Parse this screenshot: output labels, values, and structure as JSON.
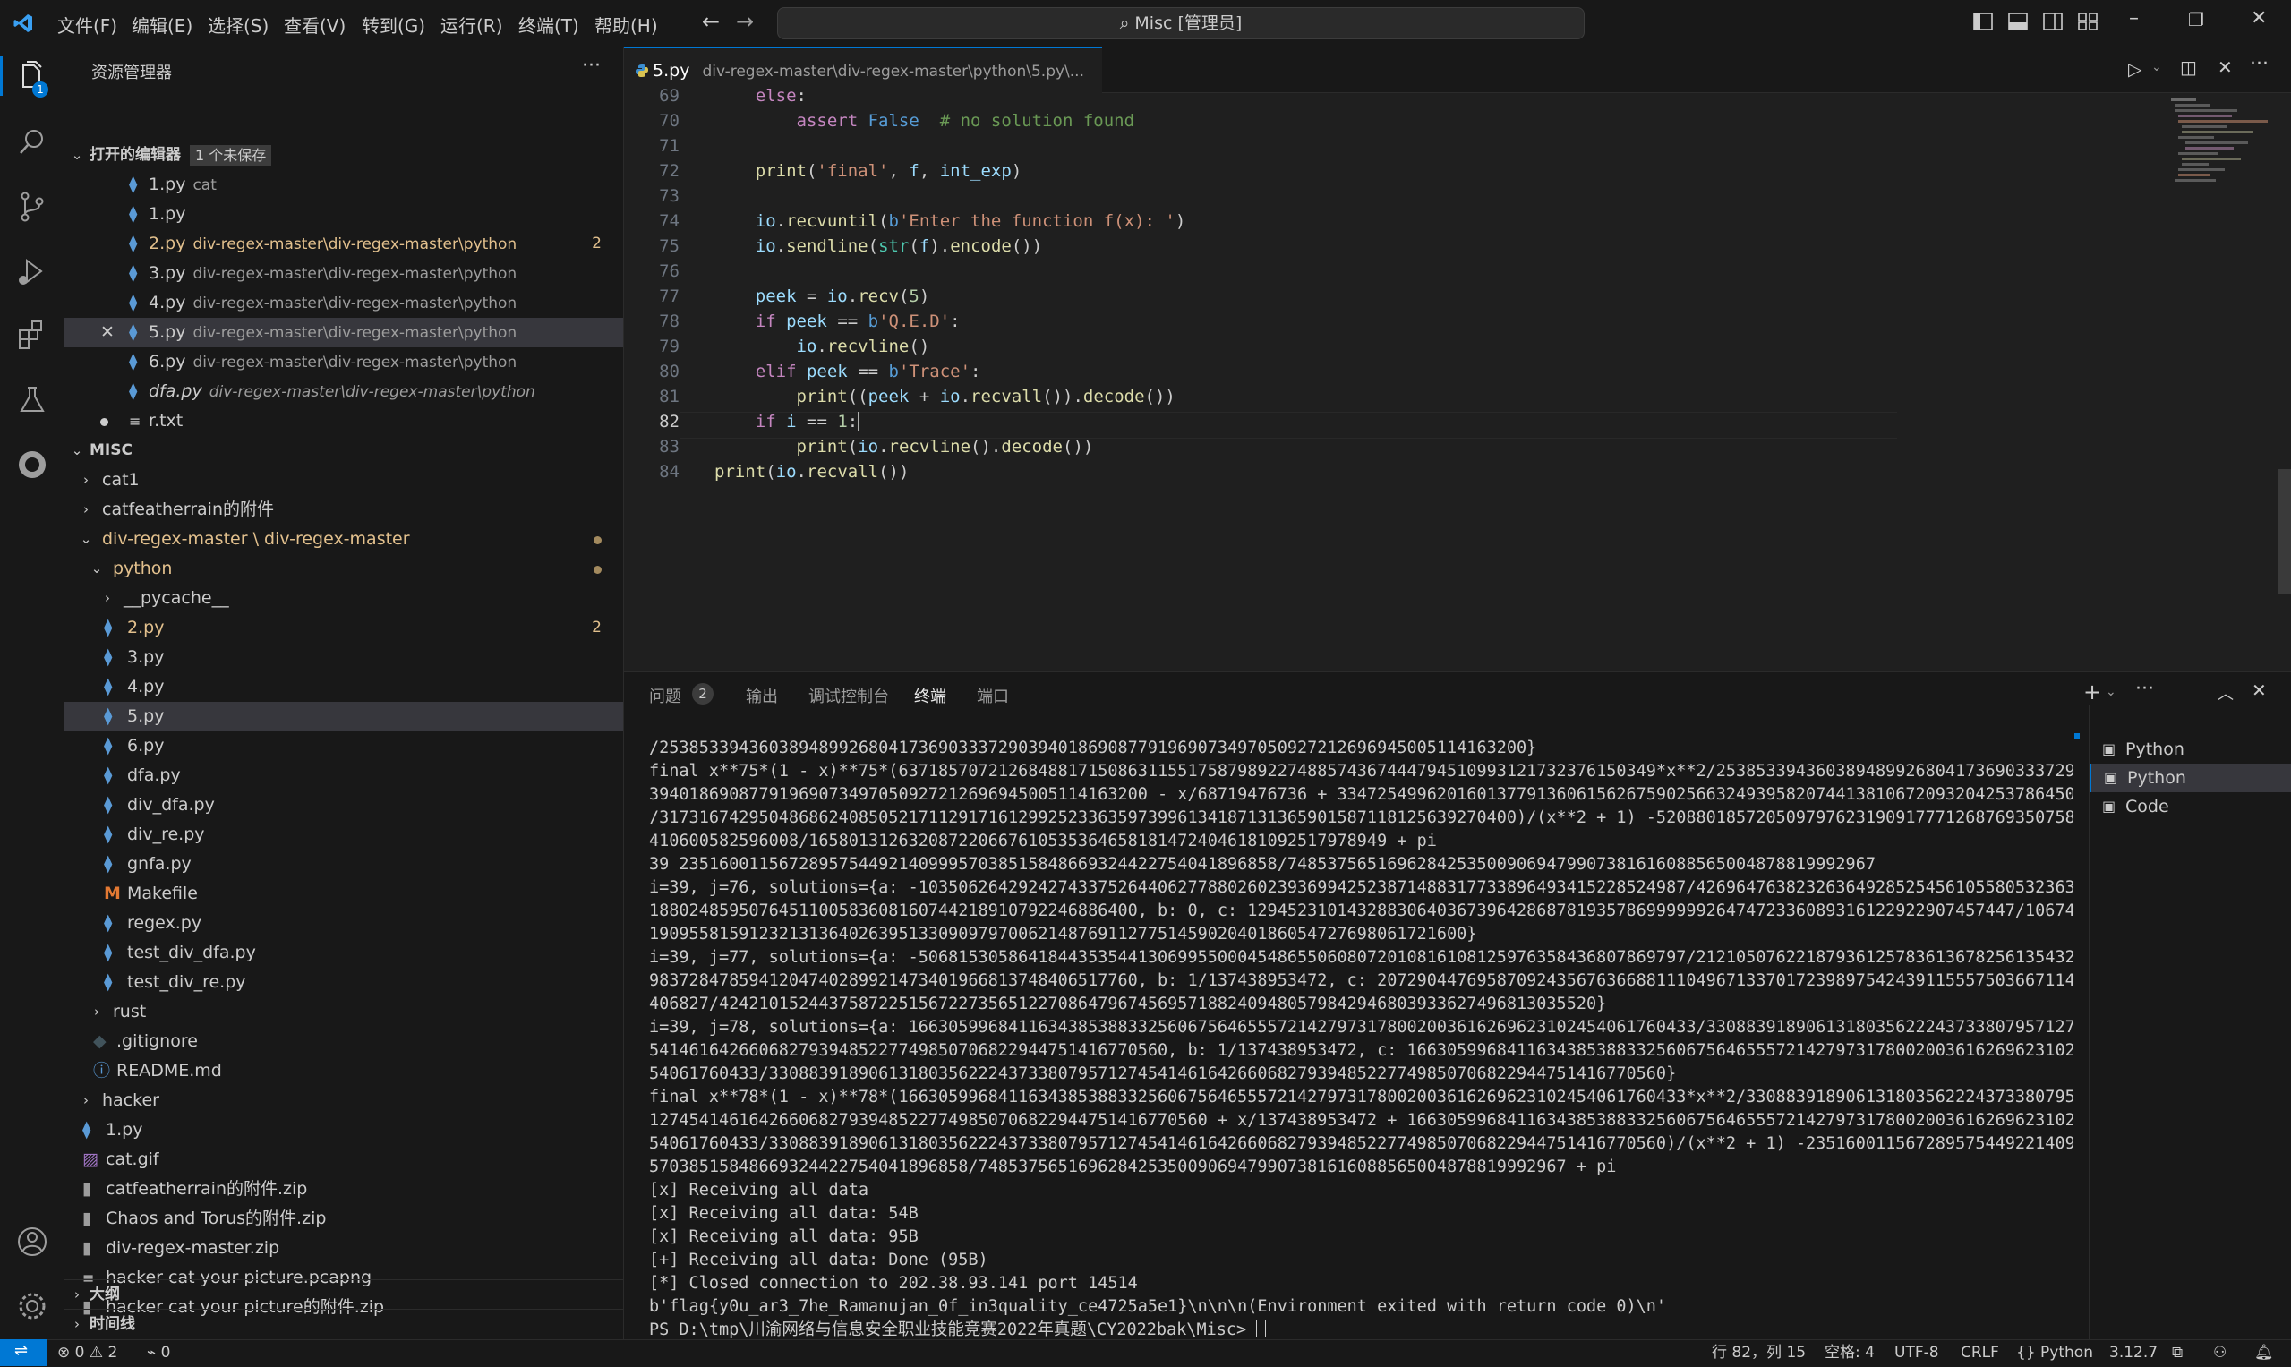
{
  "titlebar": {
    "menus": [
      "文件(F)",
      "编辑(E)",
      "选择(S)",
      "查看(V)",
      "转到(G)",
      "运行(R)",
      "终端(T)",
      "帮助(H)"
    ],
    "search": "Misc [管理员]"
  },
  "activity": {
    "explorer_badge": "1"
  },
  "sidebar": {
    "title": "资源管理器",
    "open_editors": {
      "label": "打开的编辑器",
      "unsaved": "1 个未保存",
      "items": [
        {
          "name": "1.py",
          "desc": "cat",
          "badge": ""
        },
        {
          "name": "1.py",
          "desc": "",
          "badge": ""
        },
        {
          "name": "2.py",
          "desc": "div-regex-master\\div-regex-master\\python",
          "badge": "2"
        },
        {
          "name": "3.py",
          "desc": "div-regex-master\\div-regex-master\\python",
          "badge": ""
        },
        {
          "name": "4.py",
          "desc": "div-regex-master\\div-regex-master\\python",
          "badge": ""
        },
        {
          "name": "5.py",
          "desc": "div-regex-master\\div-regex-master\\python",
          "badge": ""
        },
        {
          "name": "6.py",
          "desc": "div-regex-master\\div-regex-master\\python",
          "badge": ""
        },
        {
          "name": "dfa.py",
          "desc": "div-regex-master\\div-regex-master\\python",
          "badge": ""
        },
        {
          "name": "r.txt",
          "desc": "",
          "badge": ""
        }
      ]
    },
    "misc": {
      "label": "MISC",
      "items": [
        "cat1",
        "catfeatherrain的附件",
        "div-regex-master \\ div-regex-master",
        "python",
        "__pycache__",
        "2.py",
        "3.py",
        "4.py",
        "5.py",
        "6.py",
        "dfa.py",
        "div_dfa.py",
        "div_re.py",
        "gnfa.py",
        "Makefile",
        "regex.py",
        "test_div_dfa.py",
        "test_div_re.py",
        "rust",
        ".gitignore",
        "README.md",
        "hacker",
        "1.py",
        "cat.gif",
        "catfeatherrain的附件.zip",
        "Chaos and Torus的附件.zip",
        "div-regex-master.zip",
        "hacker cat your picture.pcapng",
        "hacker cat your picture的附件.zip"
      ],
      "badge_2py": "2"
    },
    "outline": "大纲",
    "timeline": "时间线"
  },
  "editor": {
    "tab_name": "5.py",
    "tab_path": "div-regex-master\\div-regex-master\\python\\5.py\\...",
    "line_numbers": [
      "69",
      "70",
      "71",
      "72",
      "73",
      "74",
      "75",
      "76",
      "77",
      "78",
      "79",
      "80",
      "81",
      "82",
      "83",
      "84"
    ]
  },
  "panel": {
    "tabs": [
      "问题",
      "输出",
      "调试控制台",
      "终端",
      "端口"
    ],
    "problems_count": "2",
    "terminal_lines": [
      "/253853394360389489926804173690333729039401869087791969073497050927212696945005114163200}",
      "final x**75*(1 - x)**75*(6371857072126848817150863115517587989227488574367444794510993121732376150349*x**2/2538533943603894899268041736903337290",
      "394018690877919690734970509272126969450051141632​00 - x/68719476736 + 334725499620160137791360615626759025663249395820744138106720932042537864503",
      "/31731674295048686240850521711291716129925233635973996134187131365901587118125639270400)/(x**2 + 1) -5208801857205097976231909177712687693507581",
      "410600582596008/16580131263208722066761053536465818147240461810925179789​49 + pi",
      "39 23516001156728957544921409995703851584866932442275404189685​8/74853756516962842535009069479907381616088565004878819992967",
      "i=39, j=76, solutions={a: -10350626429242743375264406277880260239369942523871488317733896493415228524987/426964763823263649285254561055805323639",
      "188024859507645110058360816074421891079224688640​0, b: 0, c: 12945231014328830640367396428687819357869999992647472336089316122922907457447/106741",
      "1909558159123213136402639513309097970062148769112775145902040186054727698061721600}",
      "i=39, j=77, solutions={a: -50681530586418443535441306995500045486550608072010816108125976358436807869797/212105076221879361257836136782561354323",
      "9837284785941204740289921473401966813748406517760, b: 1/137438953472, c: 20729044769587092435676366881110496713370172398975424391155575036671145",
      "406827/42421015244375872251567227356512270864796745695718824094805798429468039336274968130​35520}",
      "i=39, j=78, solutions={a: 16630599684116343853883325606756465557214279731780020036162696231024540617604​33/33088391890613180356222437338079571274",
      "541461642660682793948522774985070682294475141677056​0, b: 1/137438953472, c: 1663059968411634385388332560675646555721427973178002003616269623102​4",
      "54061760433/330883918906131803562224373380795712745414616426606827939485227749850706822944751416770560}",
      "final x**78*(1 - x)**78*(16630599684116343853883325606756465557214279731780020036162696231024540617604​33*x**2/3308839189061318035622243733807957",
      "1274541461642660682793948522774985070682294475141677056​0 + x/137438953472 + 16630599684116343853883325606756465557214279731780020036162696231024",
      "54061760433/33088391890613180356222437338079571274541461642660682793948522774985070682294475141677056​0)/(x**2 + 1) -235160011567289575449221409​99",
      "5703851584866932442275404189685​8/74853756516962842535009069479907381616088565004878819992967 + pi",
      "[x] Receiving all data",
      "[x] Receiving all data: 54B",
      "[x] Receiving all data: 95B",
      "[+] Receiving all data: Done (95B)",
      "[*] Closed connection to 202.38.93.141 port 14514",
      "b'flag{y0u_ar3_7he_Ramanujan_0f_in3quality_ce4725a5e1}\\n\\n\\n(Environment exited with return code 0)\\n'",
      "PS D:\\tmp\\川渝网络与信息安全职业技能竞赛2022年真题\\CY2022bak\\Misc> "
    ],
    "terminal_list": [
      "Python",
      "Python",
      "Code"
    ]
  },
  "statusbar": {
    "errors": "0",
    "warnings": "2",
    "ports": "0",
    "position": "行 82，列 15",
    "spaces": "空格: 4",
    "encoding": "UTF-8",
    "eol": "CRLF",
    "language": "Python",
    "version": "3.12.7"
  }
}
